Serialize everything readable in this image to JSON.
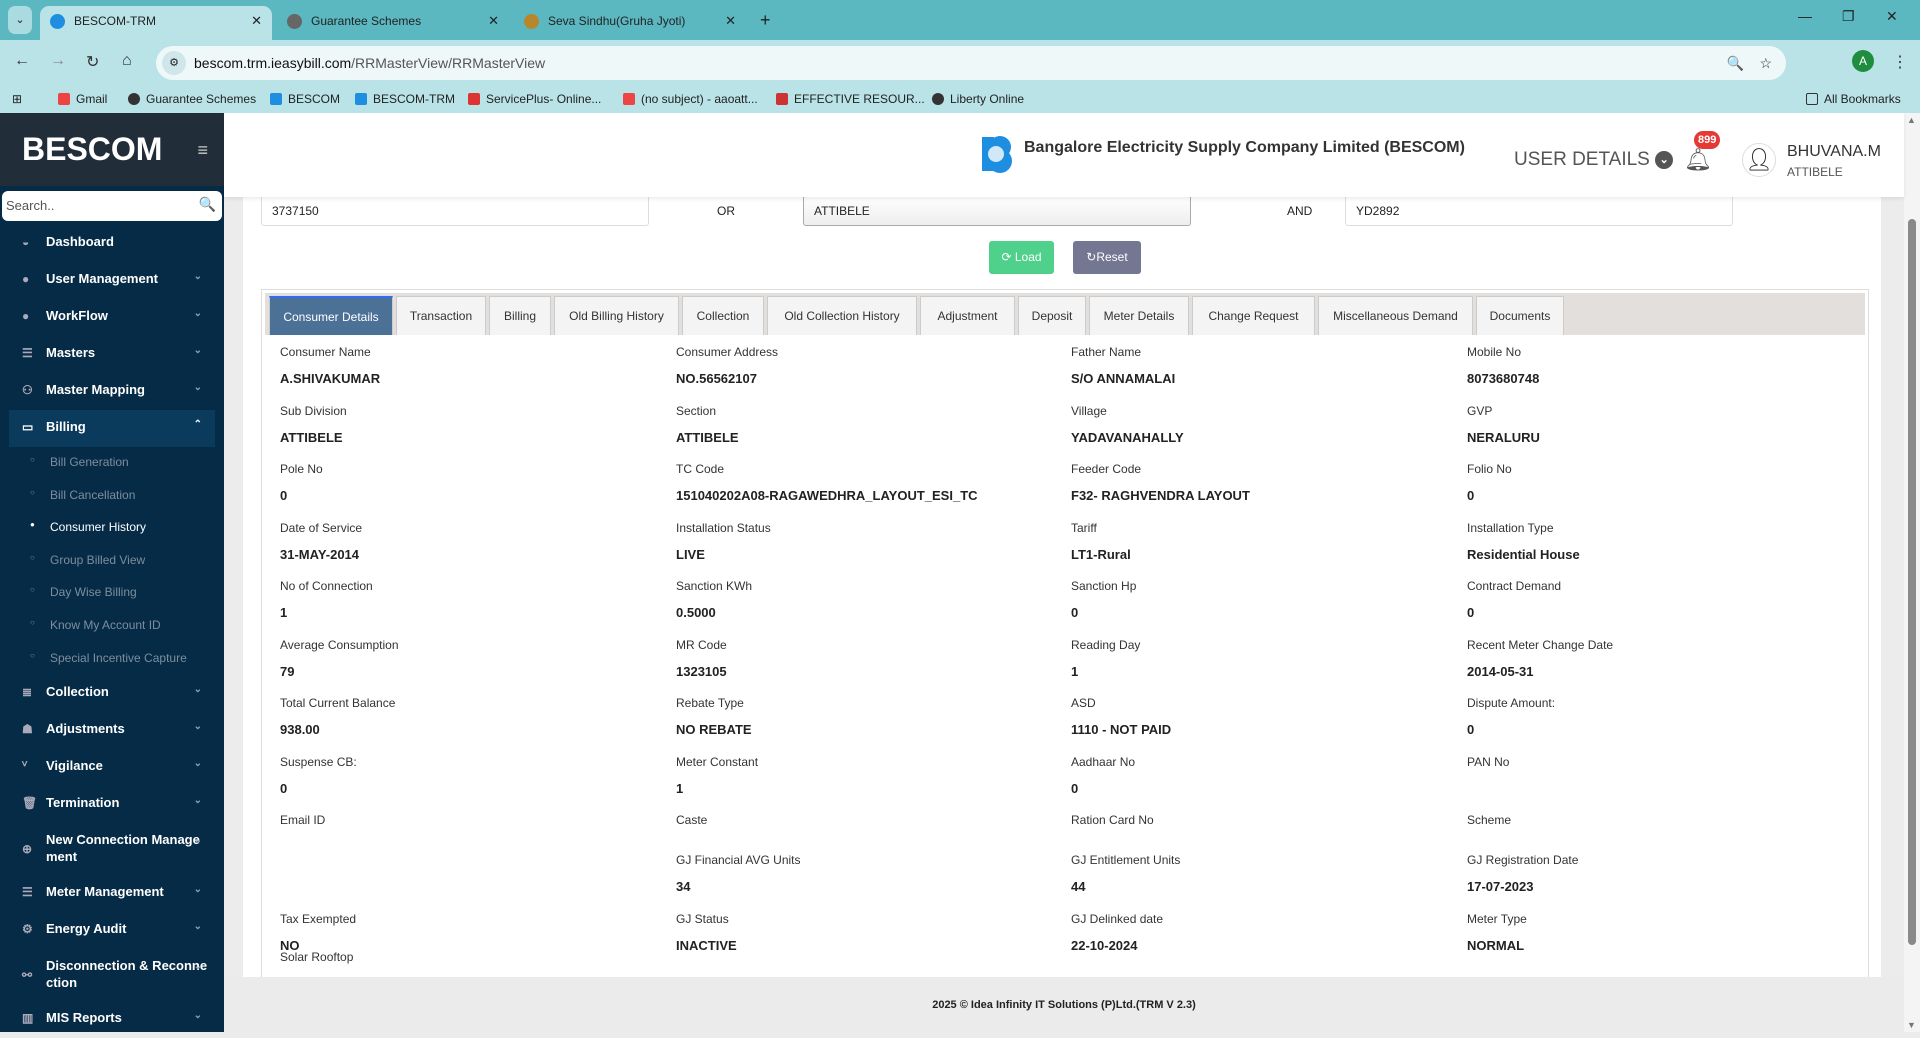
{
  "browser": {
    "tabs": [
      {
        "label": "BESCOM-TRM",
        "active": true
      },
      {
        "label": "Guarantee Schemes"
      },
      {
        "label": "Seva Sindhu(Gruha Jyoti)"
      }
    ],
    "url_host": "bescom.trm.ieasybill.com",
    "url_path": "/RRMasterView/RRMasterView",
    "profile": "A",
    "bookmarks": [
      "Gmail",
      "Guarantee Schemes",
      "BESCOM",
      "BESCOM-TRM",
      "ServicePlus- Online...",
      "(no subject) - aaoatt...",
      "EFFECTIVE RESOUR...",
      "Liberty Online"
    ],
    "all_bookmarks": "All Bookmarks"
  },
  "sidebar": {
    "brand": "BESCOM",
    "search_placeholder": "Search..",
    "items": [
      {
        "label": "Dashboard",
        "icon": "dashboard-icon"
      },
      {
        "label": "User Management"
      },
      {
        "label": "WorkFlow"
      },
      {
        "label": "Masters"
      },
      {
        "label": "Master Mapping"
      },
      {
        "label": "Billing"
      }
    ],
    "billing_sub": [
      "Bill Generation",
      "Bill Cancellation",
      "Consumer History",
      "Group Billed View",
      "Day Wise Billing",
      "Know My Account ID",
      "Special Incentive Capture"
    ],
    "items2": [
      "Collection",
      "Adjustments",
      "Vigilance",
      "Termination",
      "New Connection Manage ment",
      "Meter Management",
      "Energy Audit",
      "Disconnection & Reconne ction",
      "MIS Reports"
    ]
  },
  "header": {
    "company": "Bangalore Electricity Supply Company Limited (BESCOM)",
    "user_details": "USER DETAILS",
    "notifications": "899",
    "user_name": "BHUVANA.M",
    "user_location": "ATTIBELE"
  },
  "filters": {
    "account_id": "3737150",
    "or": "OR",
    "section": "ATTIBELE",
    "and": "AND",
    "rr_no": "YD2892",
    "load": "Load",
    "reset": "Reset"
  },
  "tabs": [
    "Consumer Details",
    "Transaction",
    "Billing",
    "Old Billing History",
    "Collection",
    "Old Collection History",
    "Adjustment",
    "Deposit",
    "Meter Details",
    "Change Request",
    "Miscellaneous Demand",
    "Documents"
  ],
  "details": [
    [
      [
        "Consumer Name",
        "A.SHIVAKUMAR"
      ],
      [
        "Consumer Address",
        "NO.56562107"
      ],
      [
        "Father Name",
        "S/O ANNAMALAI"
      ],
      [
        "Mobile No",
        "8073680748"
      ]
    ],
    [
      [
        "Sub Division",
        "ATTIBELE"
      ],
      [
        "Section",
        "ATTIBELE"
      ],
      [
        "Village",
        "YADAVANAHALLY"
      ],
      [
        "GVP",
        "NERALURU"
      ]
    ],
    [
      [
        "Pole No",
        "0"
      ],
      [
        "TC Code",
        "151040202A08-RAGAWEDHRA_LAYOUT_ESI_TC"
      ],
      [
        "Feeder Code",
        "F32- RAGHVENDRA LAYOUT"
      ],
      [
        "Folio No",
        "0"
      ]
    ],
    [
      [
        "Date of Service",
        "31-MAY-2014"
      ],
      [
        "Installation Status",
        "LIVE"
      ],
      [
        "Tariff",
        "LT1-Rural"
      ],
      [
        "Installation Type",
        "Residential House"
      ]
    ],
    [
      [
        "No of Connection",
        "1"
      ],
      [
        "Sanction KWh",
        "0.5000"
      ],
      [
        "Sanction Hp",
        "0"
      ],
      [
        "Contract Demand",
        "0"
      ]
    ],
    [
      [
        "Average Consumption",
        "79"
      ],
      [
        "MR Code",
        "1323105"
      ],
      [
        "Reading Day",
        "1"
      ],
      [
        "Recent Meter Change Date",
        "2014-05-31"
      ]
    ],
    [
      [
        "Total Current Balance",
        "938.00"
      ],
      [
        "Rebate Type",
        "NO REBATE"
      ],
      [
        "ASD",
        "1110 - NOT PAID"
      ],
      [
        "Dispute Amount:",
        "0"
      ]
    ],
    [
      [
        "Suspense CB:",
        "0"
      ],
      [
        "Meter Constant",
        "1"
      ],
      [
        "Aadhaar No",
        "0"
      ],
      [
        "PAN No",
        ""
      ]
    ],
    [
      [
        "Email ID",
        ""
      ],
      [
        "Caste",
        ""
      ],
      [
        "Ration Card No",
        ""
      ],
      [
        "Scheme",
        ""
      ]
    ],
    [
      [
        "",
        ""
      ],
      [
        "GJ Financial AVG Units",
        "34"
      ],
      [
        "GJ Entitlement Units",
        "44"
      ],
      [
        "GJ Registration Date",
        "17-07-2023"
      ]
    ],
    [
      [
        "Tax Exempted",
        "NO"
      ],
      [
        "GJ Status",
        "INACTIVE"
      ],
      [
        "GJ Delinked date",
        "22-10-2024"
      ],
      [
        "Meter Type",
        "NORMAL"
      ]
    ]
  ],
  "solar_rooftop": "Solar Rooftop",
  "footer": "2025 © Idea Infinity IT Solutions (P)Ltd.(TRM V 2.3)",
  "colors": {
    "sidebar": "#062b46",
    "load": "#4fd18b",
    "reset": "#737791",
    "active_tab": "#4c7196"
  }
}
